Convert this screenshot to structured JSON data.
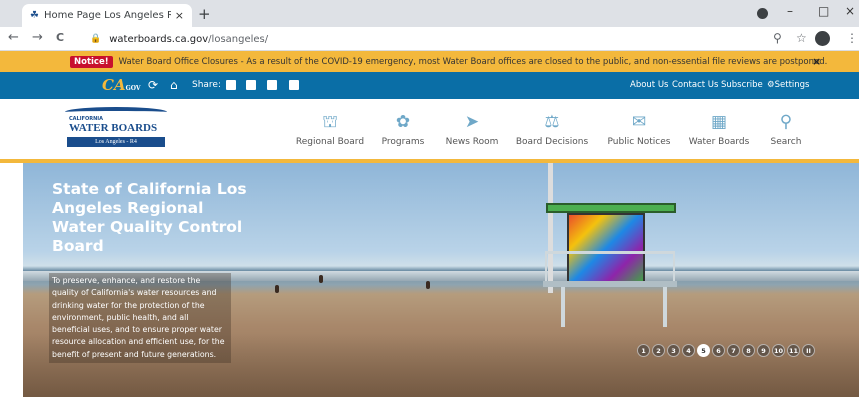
{
  "browser": {
    "tab_title": "Home Page Los Angeles Regiona",
    "tab_close": "×",
    "new_tab": "+",
    "window_controls": [
      "–",
      "□",
      "×"
    ],
    "nav": {
      "back": "←",
      "forward": "→",
      "reload": "C"
    },
    "url_host": "waterboards.ca.gov",
    "url_path": "/losangeles/",
    "toolbar_icons": [
      "zoom-icon",
      "star-icon",
      "profile-icon",
      "menu-icon"
    ]
  },
  "notice": {
    "badge": "Notice!",
    "text": "Water Board Office Closures - As a result of the COVID-19 emergency, most Water Board offices are closed to the public, and non-essential file reviews are postponed.",
    "close": "×"
  },
  "utility": {
    "ca_logo": "CA",
    "ca_logo_sub": "GOV",
    "share_label": "Share:",
    "links": [
      "About Us",
      "Contact Us",
      "Subscribe",
      "Settings"
    ]
  },
  "logo": {
    "line1": "CALIFORNIA",
    "line2": "WATER BOARDS",
    "line3": "Los Angeles - R4"
  },
  "nav": [
    {
      "label": "Regional Board",
      "icon": "building-icon"
    },
    {
      "label": "Programs",
      "icon": "leaf-icon"
    },
    {
      "label": "News Room",
      "icon": "megaphone-icon"
    },
    {
      "label": "Board Decisions",
      "icon": "scales-icon"
    },
    {
      "label": "Public Notices",
      "icon": "speech-bubble-icon"
    },
    {
      "label": "Water Boards",
      "icon": "city-icon"
    },
    {
      "label": "Search",
      "icon": "search-icon"
    }
  ],
  "hero": {
    "title": "State of California Los Angeles Regional Water Quality Control Board",
    "description": "To preserve, enhance, and restore the quality of California's water resources and drinking water for the protection of the environment, public health, and all beneficial uses, and to ensure proper water resource allocation and efficient use, for the benefit of present and future generations."
  },
  "pager": {
    "pages": [
      "1",
      "2",
      "3",
      "4",
      "5",
      "6",
      "7",
      "8",
      "9",
      "10",
      "11",
      "II"
    ],
    "active": 4
  },
  "colors": {
    "notice": "#f3b83c",
    "utility": "#0a6ea6",
    "brand": "#1a4d8c",
    "nav_icon": "#6fa8c8"
  }
}
